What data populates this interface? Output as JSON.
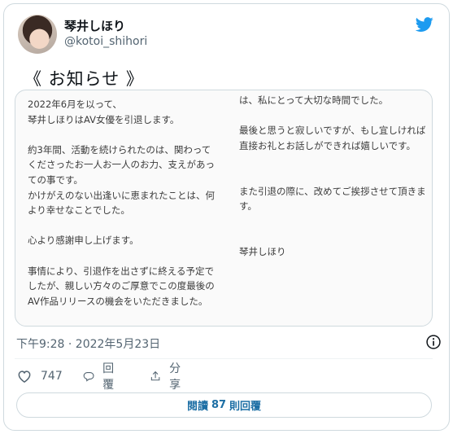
{
  "author": {
    "display_name": "琴井しほり",
    "handle": "@kotoi_shihori"
  },
  "tweet": {
    "text": "《 お知らせ 》",
    "timestamp": "下午9:28 · 2022年5月23日"
  },
  "notice_image": {
    "left_column": "2022年6月を以って、\n琴井しほりはAV女優を引退します。\n\n約3年間、活動を続けられたのは、関わって\nくださったお一人お一人のお力、支えがあっ\nての事です。\nかけがえのない出逢いに恵まれたことは、何\nより幸せなことでした。\n\n心より感謝申し上げます。\n\n事情により、引退作を出さずに終える予定で\nしたが、親しい方々のご厚意でこの度最後の\nAV作品リリースの機会をいただきました。\n\n最後まで人として真摯に接してくださった\n監督さん、プロデューサーさん",
    "right_column": "は、私にとって大切な時間でした。\n\n最後と思うと寂しいですが、もし宜しければ\n直接お礼とお話しができれば嬉しいです。\n\n\nまた引退の際に、改めてご挨拶させて頂きま\nす。\n\n\n琴井しほり"
  },
  "actions": {
    "like_count": "747",
    "reply_label": "回覆",
    "share_label": "分享"
  },
  "read_replies": {
    "prefix": "閱讀",
    "count": "87",
    "suffix": "則回覆"
  },
  "icons": {
    "brand": "twitter-bird-icon",
    "like": "heart-icon",
    "reply": "speech-bubble-icon",
    "share": "share-upload-icon",
    "info": "info-icon"
  },
  "colors": {
    "twitter_blue": "#1d9bf0",
    "secondary_text": "#536471",
    "link_text": "#1d6fa5",
    "border": "#cfd9de"
  }
}
